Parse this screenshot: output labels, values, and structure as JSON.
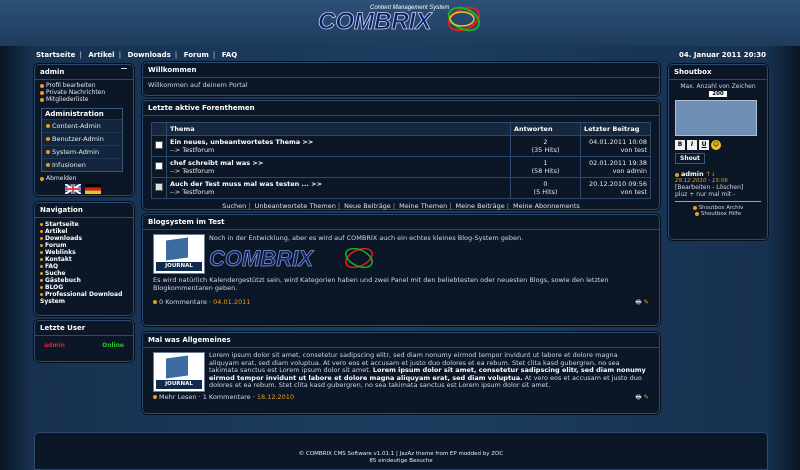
{
  "header": {
    "logo_text": "COMBRIX",
    "logo_sub": "Content Management System"
  },
  "nav": {
    "items": [
      "Startseite",
      "Artikel",
      "Downloads",
      "Forum",
      "FAQ"
    ],
    "datetime": "04. Januar 2011 20:30"
  },
  "user_panel": {
    "title": "admin",
    "links": [
      "Profil bearbeiten",
      "Private Nachrichten",
      "Mitgliederliste"
    ],
    "admin_title": "Administration",
    "admin_items": [
      "Content-Admin",
      "Benutzer-Admin",
      "System-Admin",
      "Infusionen"
    ],
    "logout": "Abmelden"
  },
  "navigation": {
    "title": "Navigation",
    "items": [
      "Startseite",
      "Artikel",
      "Downloads",
      "Forum",
      "Weblinks",
      "Kontakt",
      "FAQ",
      "Suche",
      "Gästebuch",
      "BLOG",
      "Professional Download System"
    ]
  },
  "last_user": {
    "title": "Letzte User",
    "name": "admin",
    "status": "Online"
  },
  "welcome": {
    "title": "Willkommen",
    "text": "Willkommen auf deinem Portal"
  },
  "forum": {
    "title": "Letzte aktive Forenthemen",
    "headers": [
      "Thema",
      "Antworten",
      "Letzter Beitrag"
    ],
    "rows": [
      {
        "topic": "Ein neues, unbeantwortetes Thema  >>",
        "forum": "--> Testforum",
        "answers": "2",
        "hits": "(35 Hits)",
        "date": "04.01.2011 10:08",
        "by": "von test"
      },
      {
        "topic": "chef schreibt mal was  >>",
        "forum": "--> Testforum",
        "answers": "1",
        "hits": "(58 Hits)",
        "date": "02.01.2011 19:38",
        "by": "von admin"
      },
      {
        "topic": "Auch der Test muss mal was testen ...  >>",
        "forum": "--> Testforum",
        "answers": "0",
        "hits": "(5 Hits)",
        "date": "20.12.2010 09:56",
        "by": "von test"
      }
    ],
    "links": [
      "Suchen",
      "Unbeantwortete Themen",
      "Neue Beiträge",
      "Meine Themen",
      "Meine Beiträge",
      "Meine Abonnements"
    ]
  },
  "blog": {
    "title": "Blogsystem im Test",
    "intro": "Noch in der Entwicklung, aber es wird auf COMBRIX auch ein echtes kleines Blog-System geben.",
    "body": "Es wird natürlich Kalendergestützt sein, wird Kategorien haben und zwei Panel mit den beliebtesten oder neuesten Blogs, sowie den letzten Blogkommentaren geben.",
    "comments": "0 Kommentare",
    "date": "04.01.2011",
    "journal_label": "JOURNAL"
  },
  "article": {
    "title": "Mal was Allgemeines",
    "text_a": "Lorem ipsum dolor sit amet, consetetur sadipscing elitr, sed diam nonumy eirmod tempor invidunt ut labore et dolore magna aliquyam erat, sed diam voluptua. At vero eos et accusam et justo duo dolores et ea rebum. Stet clita kasd gubergren, no sea takimata sanctus est Lorem ipsum dolor sit amet.",
    "text_bold": "Lorem ipsum dolor sit amet, consetetur sadipscing elitr, sed diam nonumy eirmod tempor invidunt ut labore et dolore magna aliquyam erat, sed diam voluptua.",
    "text_b": "At vero eos et accusam et justo duo dolores et ea rebum. Stet clita kasd gubergren, no sea takimata sanctus est Lorem ipsum dolor sit amet.",
    "more": "Mehr Lesen",
    "comments": "1 Kommentare",
    "date": "18.12.2010",
    "journal_label": "JOURNAL"
  },
  "shoutbox": {
    "title": "Shoutbox",
    "max_label": "Max. Anzahl von Zeichen",
    "counter": "200",
    "buttons": [
      "B",
      "I",
      "U"
    ],
    "submit": "Shout",
    "user": "admin",
    "shout_date": "29.12.2010 - 15:06",
    "actions": "[Bearbeiten - Löschen]",
    "message": "pluz + nur mal mit -",
    "archive": "Shoutbox Archiv",
    "help": "Shoutbox Hilfe"
  },
  "footer": {
    "line1": "© COMBRIX CMS Software v1.01.1 | JazAz theme from EP modded by ZOC",
    "line2": "85 eindeutige Besuche"
  },
  "colors": {
    "accent": "#e89b1f",
    "online": "#2fbf2f",
    "user_red": "#e02020"
  }
}
